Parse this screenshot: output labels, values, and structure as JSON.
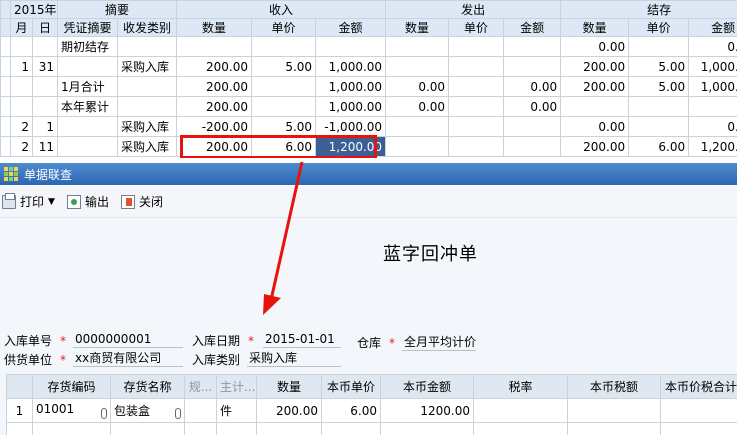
{
  "ledger": {
    "year": "2015年",
    "h_summary": "摘要",
    "h_in": "收入",
    "h_out": "发出",
    "h_bal": "结存",
    "h_month": "月",
    "h_day": "日",
    "h_voucher": "凭证摘要",
    "h_type": "收发类别",
    "h_qty": "数量",
    "h_price": "单价",
    "h_amount": "金额",
    "rows": [
      {
        "m": "",
        "d": "",
        "v": "期初结存",
        "t": "",
        "iq": "",
        "ip": "",
        "ia": "",
        "oq": "",
        "op": "",
        "oa": "",
        "bq": "0.00",
        "bp": "",
        "ba": "0.00"
      },
      {
        "m": "1",
        "d": "31",
        "v": "",
        "t": "采购入库",
        "iq": "200.00",
        "ip": "5.00",
        "ia": "1,000.00",
        "oq": "",
        "op": "",
        "oa": "",
        "bq": "200.00",
        "bp": "5.00",
        "ba": "1,000.00"
      },
      {
        "m": "",
        "d": "",
        "v": "1月合计",
        "t": "",
        "iq": "200.00",
        "ip": "",
        "ia": "1,000.00",
        "oq": "0.00",
        "op": "",
        "oa": "0.00",
        "bq": "200.00",
        "bp": "5.00",
        "ba": "1,000.00"
      },
      {
        "m": "",
        "d": "",
        "v": "本年累计",
        "t": "",
        "iq": "200.00",
        "ip": "",
        "ia": "1,000.00",
        "oq": "0.00",
        "op": "",
        "oa": "0.00",
        "bq": "",
        "bp": "",
        "ba": ""
      },
      {
        "m": "2",
        "d": "1",
        "v": "",
        "t": "采购入库",
        "iq": "-200.00",
        "ip": "5.00",
        "ia": "-1,000.00",
        "oq": "",
        "op": "",
        "oa": "",
        "bq": "0.00",
        "bp": "",
        "ba": "0.00"
      },
      {
        "m": "2",
        "d": "11",
        "v": "",
        "t": "采购入库",
        "iq": "200.00",
        "ip": "6.00",
        "ia": "1,200.00",
        "oq": "",
        "op": "",
        "oa": "",
        "bq": "200.00",
        "bp": "6.00",
        "ba": "1,200.00"
      }
    ]
  },
  "window": {
    "title": "单据联查"
  },
  "toolbar": {
    "print": "打印",
    "export": "输出",
    "close": "关闭"
  },
  "form": {
    "doc_title": "蓝字回冲单",
    "receipt_no_label": "入库单号",
    "receipt_no": "0000000001",
    "receipt_date_label": "入库日期",
    "receipt_date": "2015-01-01",
    "warehouse_label": "仓库",
    "warehouse": "全月平均计价",
    "supplier_label": "供货单位",
    "supplier": "xx商贸有限公司",
    "receipt_type_label": "入库类别",
    "receipt_type": "采购入库"
  },
  "detail": {
    "headers": [
      "存货编码",
      "存货名称",
      "规...",
      "主计...",
      "数量",
      "本币单价",
      "本币金额",
      "税率",
      "本币税额",
      "本币价税合计"
    ],
    "row": {
      "no": "1",
      "code": "01001",
      "name": "包装盒",
      "spec": "",
      "unit": "件",
      "qty": "200.00",
      "price": "6.00",
      "amount": "1200.00",
      "tax_rate": "",
      "tax": "",
      "total": ""
    }
  },
  "colors": {
    "accent": "#2c66b2",
    "highlight": "#e8130b",
    "selected": "#3c5f94"
  }
}
